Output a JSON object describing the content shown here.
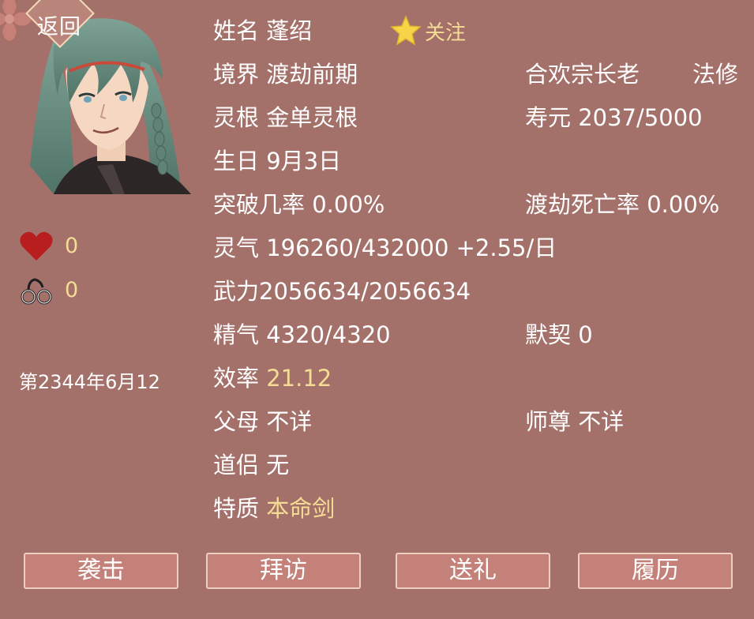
{
  "back": {
    "label": "返回"
  },
  "stats": {
    "favor": "0",
    "bond": "0"
  },
  "date": "第2344年6月12",
  "follow": {
    "label": "关注"
  },
  "info": {
    "name_label": "姓名",
    "name": "蓬绍",
    "realm_label": "境界",
    "realm": "渡劫前期",
    "sect_title": "合欢宗长老",
    "class": "法修",
    "root_label": "灵根",
    "root": "金单灵根",
    "life_label": "寿元",
    "life": "2037/5000",
    "birthday_label": "生日",
    "birthday": "9月3日",
    "breakthrough_label": "突破几率",
    "breakthrough": "0.00%",
    "tribulation_label": "渡劫死亡率",
    "tribulation": "0.00%",
    "qi_label": "灵气",
    "qi": "196260/432000 +2.55/日",
    "force_label": "武力",
    "force": "2056634/2056634",
    "essence_label": "精气",
    "essence": "4320/4320",
    "pact_label": "默契",
    "pact": "0",
    "efficiency_label": "效率",
    "efficiency": "21.12",
    "parents_label": "父母",
    "parents": "不详",
    "master_label": "师尊",
    "master": "不详",
    "partner_label": "道侣",
    "partner": "无",
    "trait_label": "特质",
    "trait": "本命剑"
  },
  "buttons": {
    "attack": "袭击",
    "visit": "拜访",
    "gift": "送礼",
    "history": "履历"
  },
  "colors": {
    "background": "#a4706a",
    "accent_gold": "#f5dc95",
    "button": "#c48179",
    "heart": "#b81e1e"
  }
}
